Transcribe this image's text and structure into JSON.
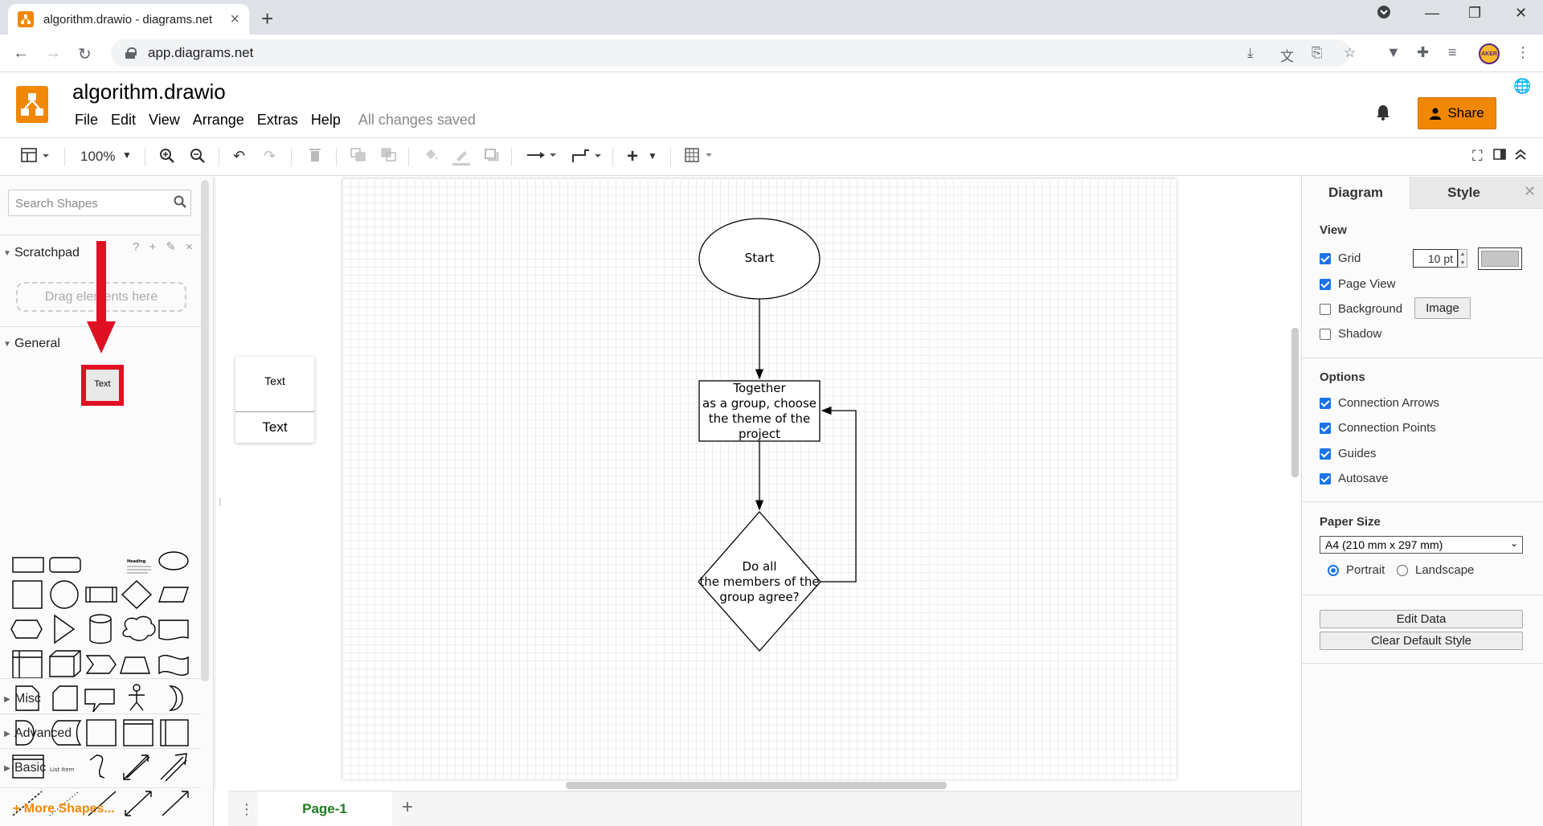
{
  "browser": {
    "tab_title": "algorithm.drawio - diagrams.net",
    "url": "app.diagrams.net",
    "profile_initials": "AKER"
  },
  "app": {
    "title": "algorithm.drawio",
    "menu": [
      "File",
      "Edit",
      "View",
      "Arrange",
      "Extras",
      "Help"
    ],
    "save_status": "All changes saved",
    "share_label": "Share",
    "brand_color": "#f08705"
  },
  "toolbar": {
    "zoom": "100%",
    "icons": [
      "format-panel-icon",
      "zoom-in-icon",
      "zoom-out-icon",
      "undo-icon",
      "redo-icon",
      "delete-icon",
      "to-front-icon",
      "to-back-icon",
      "fill-color-icon",
      "line-color-icon",
      "shadow-icon",
      "connection-icon",
      "waypoints-icon",
      "insert-icon",
      "table-icon",
      "fullscreen-icon",
      "toggle-panel-icon",
      "collapse-icon"
    ]
  },
  "sidebar": {
    "search_placeholder": "Search Shapes",
    "scratchpad_title": "Scratchpad",
    "scratchpad_actions": "? + ✎ ×",
    "dropzone": "Drag elements here",
    "general_title": "General",
    "highlighted_shape_label": "Text",
    "list_item_label": "List Item",
    "sections": [
      "Misc",
      "Advanced",
      "Basic"
    ],
    "more_shapes": "More Shapes..."
  },
  "preview": {
    "top_label": "Text",
    "bottom_label": "Text"
  },
  "diagram": {
    "start": "Start",
    "process": [
      "Together",
      "as a group, choose",
      "the theme of the",
      "project"
    ],
    "decision": [
      "Do all",
      "the members of the",
      "group agree?"
    ]
  },
  "pages": {
    "current": "Page-1"
  },
  "format_panel": {
    "tabs": [
      "Diagram",
      "Style"
    ],
    "view_title": "View",
    "grid": {
      "label": "Grid",
      "checked": true,
      "size": "10 pt"
    },
    "page_view": {
      "label": "Page View",
      "checked": true
    },
    "background": {
      "label": "Background",
      "checked": false,
      "button": "Image"
    },
    "shadow": {
      "label": "Shadow",
      "checked": false
    },
    "options_title": "Options",
    "options": [
      {
        "label": "Connection Arrows",
        "checked": true
      },
      {
        "label": "Connection Points",
        "checked": true
      },
      {
        "label": "Guides",
        "checked": true
      },
      {
        "label": "Autosave",
        "checked": true
      }
    ],
    "paper_title": "Paper Size",
    "paper_size": "A4 (210 mm x 297 mm)",
    "orientation": {
      "portrait": "Portrait",
      "landscape": "Landscape",
      "selected": "Portrait"
    },
    "edit_data": "Edit Data",
    "clear_style": "Clear Default Style"
  }
}
